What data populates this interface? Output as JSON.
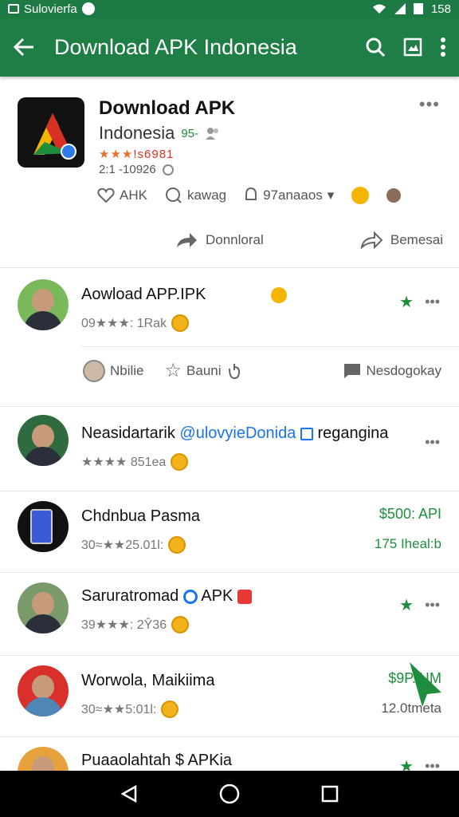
{
  "status_bar": {
    "left_text": "Sulovierfa",
    "time": "158"
  },
  "app_bar": {
    "title": "Download APK Indonesia"
  },
  "header": {
    "title": "Download APK",
    "subtitle": "Indonesia",
    "subtitle_tag": "95-",
    "rating_stars": "★★★",
    "rating_text": "!s6981",
    "meta": "2:1 -10926",
    "more": "•••",
    "actions": [
      {
        "label": "AHK",
        "icon": "heart-icon"
      },
      {
        "label": "kawag",
        "icon": "comment-icon"
      },
      {
        "label": "97anaaos",
        "icon": "bell-icon"
      }
    ],
    "download_label": "Donnloral",
    "share_label": "Bemesai"
  },
  "items": [
    {
      "title": "Aowload APP.IPK",
      "sub": "09★★★: 1Rak",
      "more": "•••"
    },
    {
      "title_pre": "Neasidartarik ",
      "title_hl": "@ulovyieDonida",
      "title_post": " regangina",
      "sub": "★★★★ 851ea",
      "more": "•••"
    },
    {
      "title": "Chdnbua Pasma",
      "sub": "30≈★★25.01l:",
      "price": "$500: API",
      "price_sub": "175 Iheal:b"
    },
    {
      "title": "Saruratromad",
      "title_post": " APK",
      "sub": "39★★★: 2Ŷ36",
      "more": "•••"
    },
    {
      "title": "Worwola, Maikiima",
      "sub": "30≈★★5:01l:",
      "price": "$9P.AIM",
      "price_sub": "12.0tmeta"
    },
    {
      "title": "Puaaolahtah $ APKia",
      "more": "•••"
    }
  ],
  "reactions": [
    {
      "label": "Nbilie"
    },
    {
      "label": "Bauni"
    },
    {
      "label": "Nesdogokay"
    }
  ],
  "colors": {
    "primary": "#1f7d46",
    "accent_green": "#1e8e3e",
    "link_blue": "#1a73e8"
  }
}
